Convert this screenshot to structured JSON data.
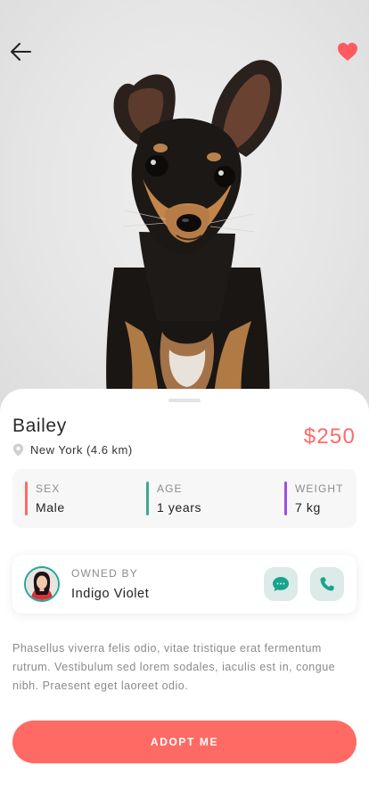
{
  "header": {
    "back_icon": "arrow-left-icon",
    "favorite_icon": "heart-icon",
    "favorite_color": "#ff5a5f"
  },
  "pet": {
    "name": "Bailey",
    "location": "New York (4.6 km)",
    "location_icon": "map-pin-icon",
    "price": "$250"
  },
  "stats": [
    {
      "label": "SEX",
      "value": "Male",
      "color": "#ff6a64"
    },
    {
      "label": "AGE",
      "value": "1 years",
      "color": "#3aa99a"
    },
    {
      "label": "WEIGHT",
      "value": "7 kg",
      "color": "#9b4fe0"
    }
  ],
  "owner": {
    "label": "OWNED BY",
    "name": "Indigo Violet",
    "message_icon": "chat-bubble-icon",
    "call_icon": "phone-icon"
  },
  "description": "Phasellus viverra felis odio, vitae tristique erat fermentum rutrum. Vestibulum sed lorem sodales, iaculis est in, congue nibh. Praesent eget laoreet odio.",
  "cta": {
    "label": "ADOPT ME",
    "color": "#ff6a64"
  }
}
